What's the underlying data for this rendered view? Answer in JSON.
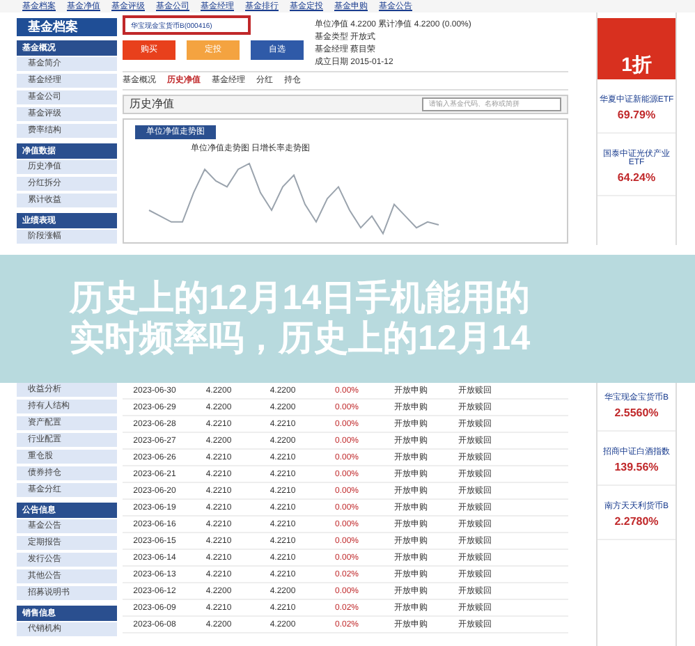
{
  "top_links": [
    "基金档案",
    "基金净值",
    "基金评级",
    "基金公司",
    "基金经理",
    "基金排行",
    "基金定投",
    "基金申购",
    "基金公告"
  ],
  "logo": "基金档案",
  "search": {
    "value": "华宝现金宝货币B(000416)"
  },
  "buttons": [
    {
      "label": "购买",
      "kind": "red"
    },
    {
      "label": "定投",
      "kind": "orange"
    },
    {
      "label": "自选",
      "kind": "blue"
    }
  ],
  "info": [
    "单位净值 4.2200 累计净值 4.2200 (0.00%)",
    "基金类型 开放式",
    "基金经理 蔡目荣",
    "成立日期 2015-01-12"
  ],
  "tabs": [
    {
      "label": "基金概况",
      "selected": false
    },
    {
      "label": "历史净值",
      "selected": true
    },
    {
      "label": "基金经理",
      "selected": false
    },
    {
      "label": "分红",
      "selected": false
    },
    {
      "label": "持仓",
      "selected": false
    }
  ],
  "section_title": "历史净值",
  "query": {
    "placeholder": "请输入基金代码、名称或简拼"
  },
  "chart": {
    "tab": "单位净值走势图",
    "title": "单位净值走势图 日增长率走势图"
  },
  "sidebar_top": [
    {
      "kind": "heading",
      "label": "基金概况"
    },
    {
      "kind": "item",
      "label": "基金简介"
    },
    {
      "kind": "item",
      "label": "基金经理"
    },
    {
      "kind": "item",
      "label": "基金公司"
    },
    {
      "kind": "item",
      "label": "基金评级"
    },
    {
      "kind": "item",
      "label": "费率结构"
    },
    {
      "kind": "heading",
      "label": "净值数据"
    },
    {
      "kind": "item",
      "label": "历史净值"
    },
    {
      "kind": "item",
      "label": "分红拆分"
    },
    {
      "kind": "item",
      "label": "累计收益"
    },
    {
      "kind": "heading",
      "label": "业绩表现"
    },
    {
      "kind": "item",
      "label": "阶段涨幅"
    }
  ],
  "sidebar_bottom": [
    {
      "kind": "item",
      "label": "收益分析"
    },
    {
      "kind": "item",
      "label": "持有人结构"
    },
    {
      "kind": "item",
      "label": "资产配置"
    },
    {
      "kind": "item",
      "label": "行业配置"
    },
    {
      "kind": "item",
      "label": "重仓股"
    },
    {
      "kind": "item",
      "label": "债券持仓"
    },
    {
      "kind": "item",
      "label": "基金分红"
    },
    {
      "kind": "heading",
      "label": "公告信息"
    },
    {
      "kind": "item",
      "label": "基金公告"
    },
    {
      "kind": "item",
      "label": "定期报告"
    },
    {
      "kind": "item",
      "label": "发行公告"
    },
    {
      "kind": "item",
      "label": "其他公告"
    },
    {
      "kind": "item",
      "label": "招募说明书"
    },
    {
      "kind": "heading",
      "label": "销售信息"
    },
    {
      "kind": "item",
      "label": "代销机构"
    }
  ],
  "table": {
    "rows": [
      [
        "2023-06-30",
        "4.2200",
        "4.2200",
        "0.00%",
        "开放申购",
        "开放赎回"
      ],
      [
        "2023-06-29",
        "4.2200",
        "4.2200",
        "0.00%",
        "开放申购",
        "开放赎回"
      ],
      [
        "2023-06-28",
        "4.2210",
        "4.2210",
        "0.00%",
        "开放申购",
        "开放赎回"
      ],
      [
        "2023-06-27",
        "4.2200",
        "4.2200",
        "0.00%",
        "开放申购",
        "开放赎回"
      ],
      [
        "2023-06-26",
        "4.2210",
        "4.2210",
        "0.00%",
        "开放申购",
        "开放赎回"
      ],
      [
        "2023-06-21",
        "4.2210",
        "4.2210",
        "0.00%",
        "开放申购",
        "开放赎回"
      ],
      [
        "2023-06-20",
        "4.2210",
        "4.2210",
        "0.00%",
        "开放申购",
        "开放赎回"
      ],
      [
        "2023-06-19",
        "4.2210",
        "4.2210",
        "0.00%",
        "开放申购",
        "开放赎回"
      ],
      [
        "2023-06-16",
        "4.2210",
        "4.2210",
        "0.00%",
        "开放申购",
        "开放赎回"
      ],
      [
        "2023-06-15",
        "4.2210",
        "4.2210",
        "0.00%",
        "开放申购",
        "开放赎回"
      ],
      [
        "2023-06-14",
        "4.2210",
        "4.2210",
        "0.00%",
        "开放申购",
        "开放赎回"
      ],
      [
        "2023-06-13",
        "4.2210",
        "4.2210",
        "0.02%",
        "开放申购",
        "开放赎回"
      ],
      [
        "2023-06-12",
        "4.2200",
        "4.2200",
        "0.00%",
        "开放申购",
        "开放赎回"
      ],
      [
        "2023-06-09",
        "4.2210",
        "4.2210",
        "0.02%",
        "开放申购",
        "开放赎回"
      ],
      [
        "2023-06-08",
        "4.2200",
        "4.2200",
        "0.02%",
        "开放申购",
        "开放赎回"
      ]
    ]
  },
  "ad": {
    "badge": "1折",
    "top_items": [
      {
        "name": "华夏中证新能源ETF",
        "value": "69.79%"
      },
      {
        "name": "国泰中证光伏产业ETF",
        "value": "64.24%"
      }
    ],
    "bottom_items": [
      {
        "name": "华宝现金宝货币B",
        "value": "2.5560%"
      },
      {
        "name": "招商中证白酒指数",
        "value": "139.56%"
      },
      {
        "name": "南方天天利货币B",
        "value": "2.2780%"
      }
    ]
  },
  "overlay": [
    "历史上的12月14日手机能用的",
    "实时频率吗，历史上的12月14"
  ]
}
